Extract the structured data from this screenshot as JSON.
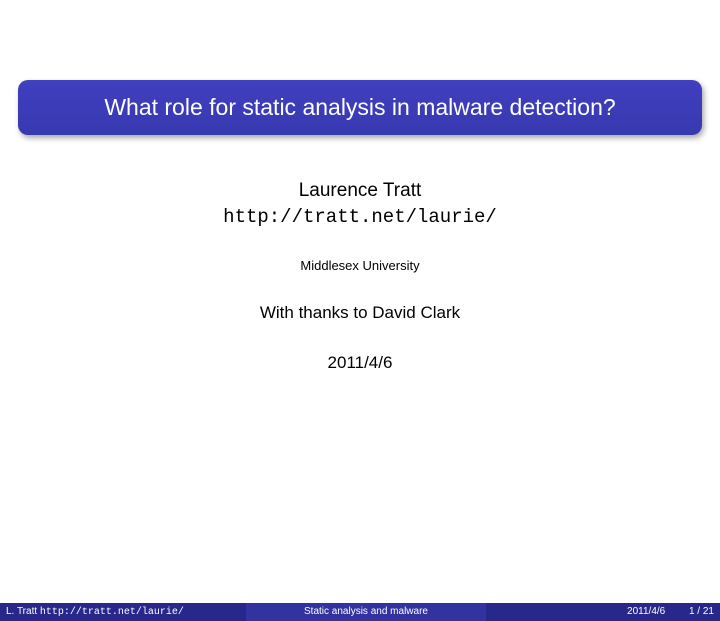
{
  "title": "What role for static analysis in malware detection?",
  "author": "Laurence Tratt",
  "author_url": "http://tratt.net/laurie/",
  "affiliation": "Middlesex University",
  "thanks": "With thanks to David Clark",
  "date": "2011/4/6",
  "footer": {
    "author_short": "L. Tratt",
    "author_url": "http://tratt.net/laurie/",
    "short_title": "Static analysis and malware",
    "date": "2011/4/6",
    "page": "1 / 21"
  }
}
